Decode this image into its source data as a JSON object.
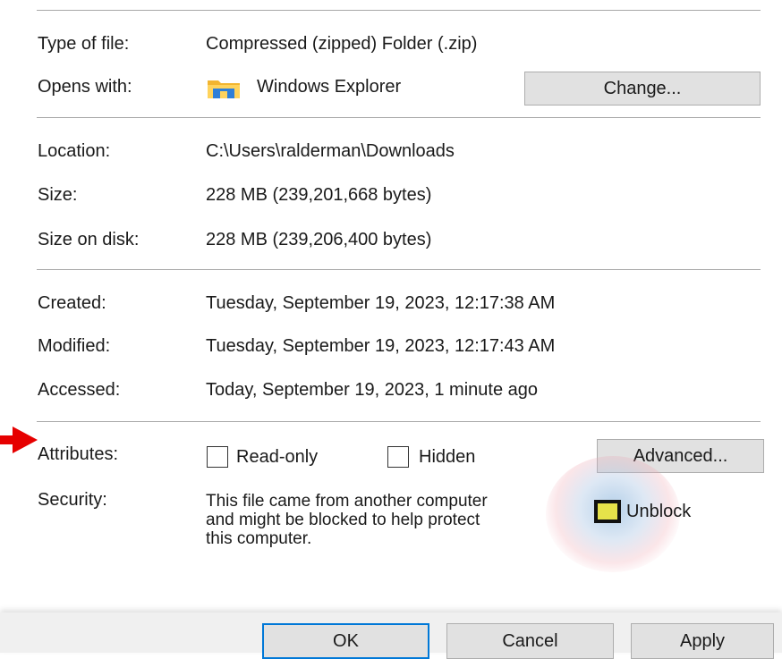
{
  "properties": {
    "type_of_file": {
      "label": "Type of file:",
      "value": "Compressed (zipped) Folder (.zip)"
    },
    "opens_with": {
      "label": "Opens with:",
      "value": "Windows Explorer",
      "change_button": "Change...",
      "icon": "windows-explorer-folder-icon"
    },
    "location": {
      "label": "Location:",
      "value": "C:\\Users\\ralderman\\Downloads"
    },
    "size": {
      "label": "Size:",
      "value": "228 MB (239,201,668 bytes)"
    },
    "size_on_disk": {
      "label": "Size on disk:",
      "value": "228 MB (239,206,400 bytes)"
    },
    "created": {
      "label": "Created:",
      "value": "Tuesday, September 19, 2023, 12:17:38 AM"
    },
    "modified": {
      "label": "Modified:",
      "value": "Tuesday, September 19, 2023, 12:17:43 AM"
    },
    "accessed": {
      "label": "Accessed:",
      "value": "Today, September 19, 2023, 1 minute ago"
    }
  },
  "attributes": {
    "label": "Attributes:",
    "read_only": {
      "label": "Read-only",
      "checked": false
    },
    "hidden": {
      "label": "Hidden",
      "checked": false
    },
    "advanced_button": "Advanced..."
  },
  "security": {
    "label": "Security:",
    "message": "This file came from another computer\nand might be blocked to help protect\nthis computer.",
    "unblock": {
      "label": "Unblock",
      "highlighted": true
    }
  },
  "footer": {
    "ok": "OK",
    "cancel": "Cancel",
    "apply": "Apply"
  },
  "annotation": {
    "arrow_color": "#e60000",
    "highlight_color": "#e6e24a"
  }
}
